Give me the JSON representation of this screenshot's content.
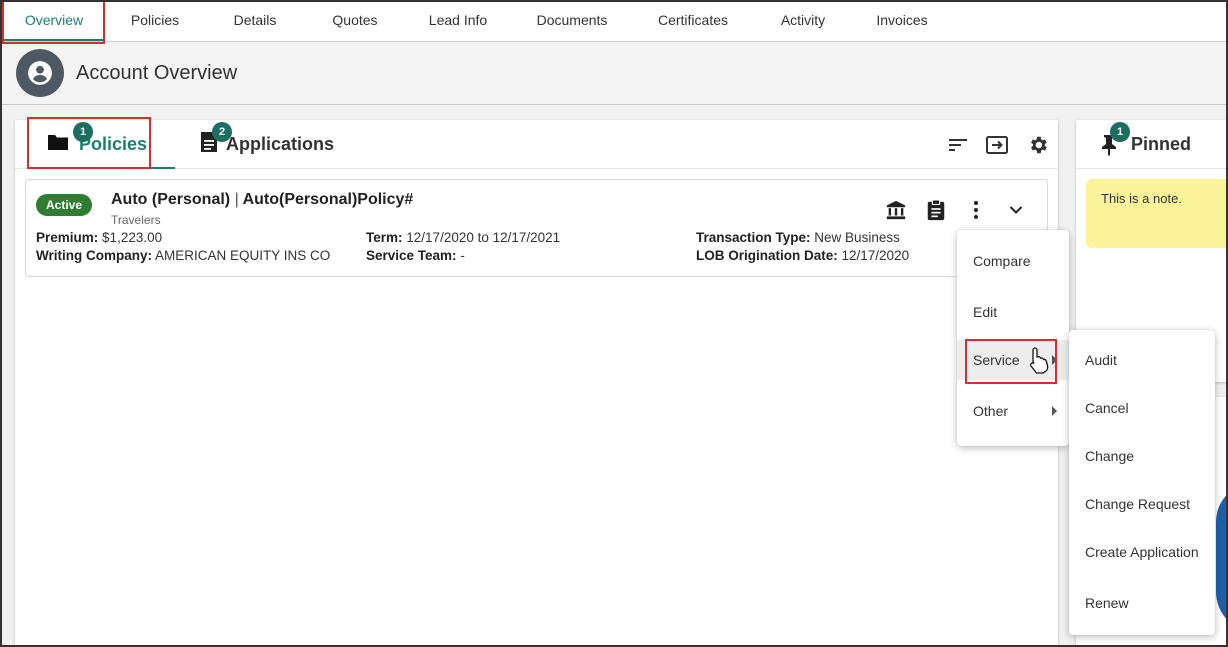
{
  "nav": {
    "tabs": [
      {
        "label": "Overview",
        "active": true
      },
      {
        "label": "Policies"
      },
      {
        "label": "Details"
      },
      {
        "label": "Quotes"
      },
      {
        "label": "Lead Info"
      },
      {
        "label": "Documents"
      },
      {
        "label": "Certificates"
      },
      {
        "label": "Activity"
      },
      {
        "label": "Invoices"
      }
    ]
  },
  "header": {
    "title": "Account Overview",
    "avatar_icon": "account-circle-icon"
  },
  "card_tabs": {
    "policies": {
      "label": "Policies",
      "count": "1",
      "icon": "folder-icon"
    },
    "applications": {
      "label": "Applications",
      "count": "2",
      "icon": "document-icon"
    },
    "tools": [
      "sort-icon",
      "export-icon",
      "gear-icon"
    ]
  },
  "policy": {
    "status": "Active",
    "line": "Auto (Personal)",
    "separator": "|",
    "policy_label": "Auto(Personal)Policy#",
    "carrier": "Travelers",
    "premium_label": "Premium:",
    "premium_value": "$1,223.00",
    "writing_label": "Writing Company:",
    "writing_value": "AMERICAN EQUITY INS CO",
    "term_label": "Term:",
    "term_value": "12/17/2020 to 12/17/2021",
    "team_label": "Service Team:",
    "team_value": "-",
    "txn_label": "Transaction Type:",
    "txn_value": "New Business",
    "lob_label": "LOB Origination Date:",
    "lob_value": "12/17/2020"
  },
  "pinned": {
    "title": "Pinned",
    "count": "1",
    "note": "This is a note."
  },
  "context_menu": {
    "items": [
      "Compare",
      "Edit",
      "Service",
      "Other"
    ]
  },
  "submenu": {
    "items": [
      "Audit",
      "Cancel",
      "Change",
      "Change Request",
      "Create Application",
      "Renew"
    ]
  },
  "colors": {
    "accent": "#1b7f6e",
    "status_active": "#2e7d32",
    "highlight": "#d32f2f",
    "note": "#fbf39a"
  }
}
